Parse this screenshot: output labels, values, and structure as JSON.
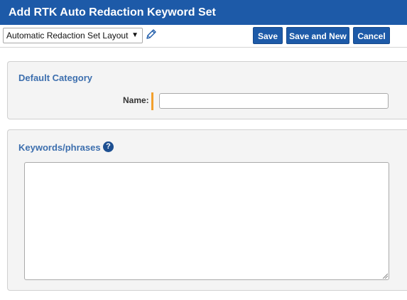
{
  "window": {
    "title": "Add RTK Auto Redaction Keyword Set"
  },
  "toolbar": {
    "layout_selected": "Automatic Redaction Set Layout",
    "layout_arrow": "▼",
    "edit_layout_icon": "pencil-icon",
    "save_label": "Save",
    "save_and_new_label": "Save and New",
    "cancel_label": "Cancel"
  },
  "default_category": {
    "heading": "Default Category",
    "name_label": "Name:",
    "name_value": "",
    "required": true
  },
  "keywords": {
    "heading": "Keywords/phrases",
    "help_icon_glyph": "?",
    "help_icon": "question-circle-icon",
    "value": ""
  },
  "colors": {
    "header_bg": "#1d5aa8",
    "button_bg": "#1d5aa8",
    "section_heading": "#3d6fae",
    "required_marker": "#f2a02d",
    "panel_bg": "#f4f4f4"
  }
}
